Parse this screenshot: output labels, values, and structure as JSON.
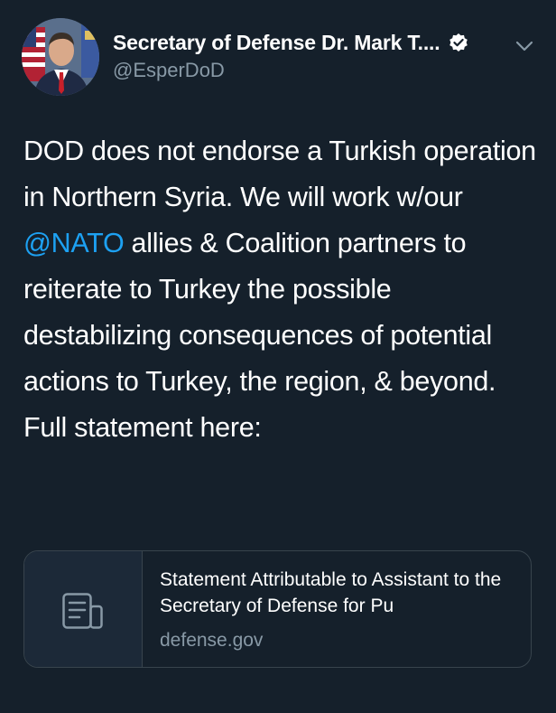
{
  "tweet": {
    "author": {
      "display_name": "Secretary of Defense Dr. Mark T....",
      "handle": "@EsperDoD",
      "verified": true,
      "avatar_icon": "profile-photo"
    },
    "menu_icon": "chevron-down-icon",
    "text_before_mention": "DOD does not endorse a Turkish operation in Northern Syria. We will work w/our ",
    "mention": "@NATO",
    "text_after_mention": " allies & Coalition partners to reiterate to Turkey the possible destabilizing consequences of potential actions to Turkey, the region, & beyond. Full statement here:",
    "link_card": {
      "title": "Statement Attributable to Assistant to the Secretary of Defense for Pu",
      "domain": "defense.gov",
      "thumbnail_icon": "document-icon"
    }
  },
  "colors": {
    "background": "#15202b",
    "text": "#ffffff",
    "secondary_text": "#8899a6",
    "link": "#1da1f2",
    "border": "#38444d"
  }
}
